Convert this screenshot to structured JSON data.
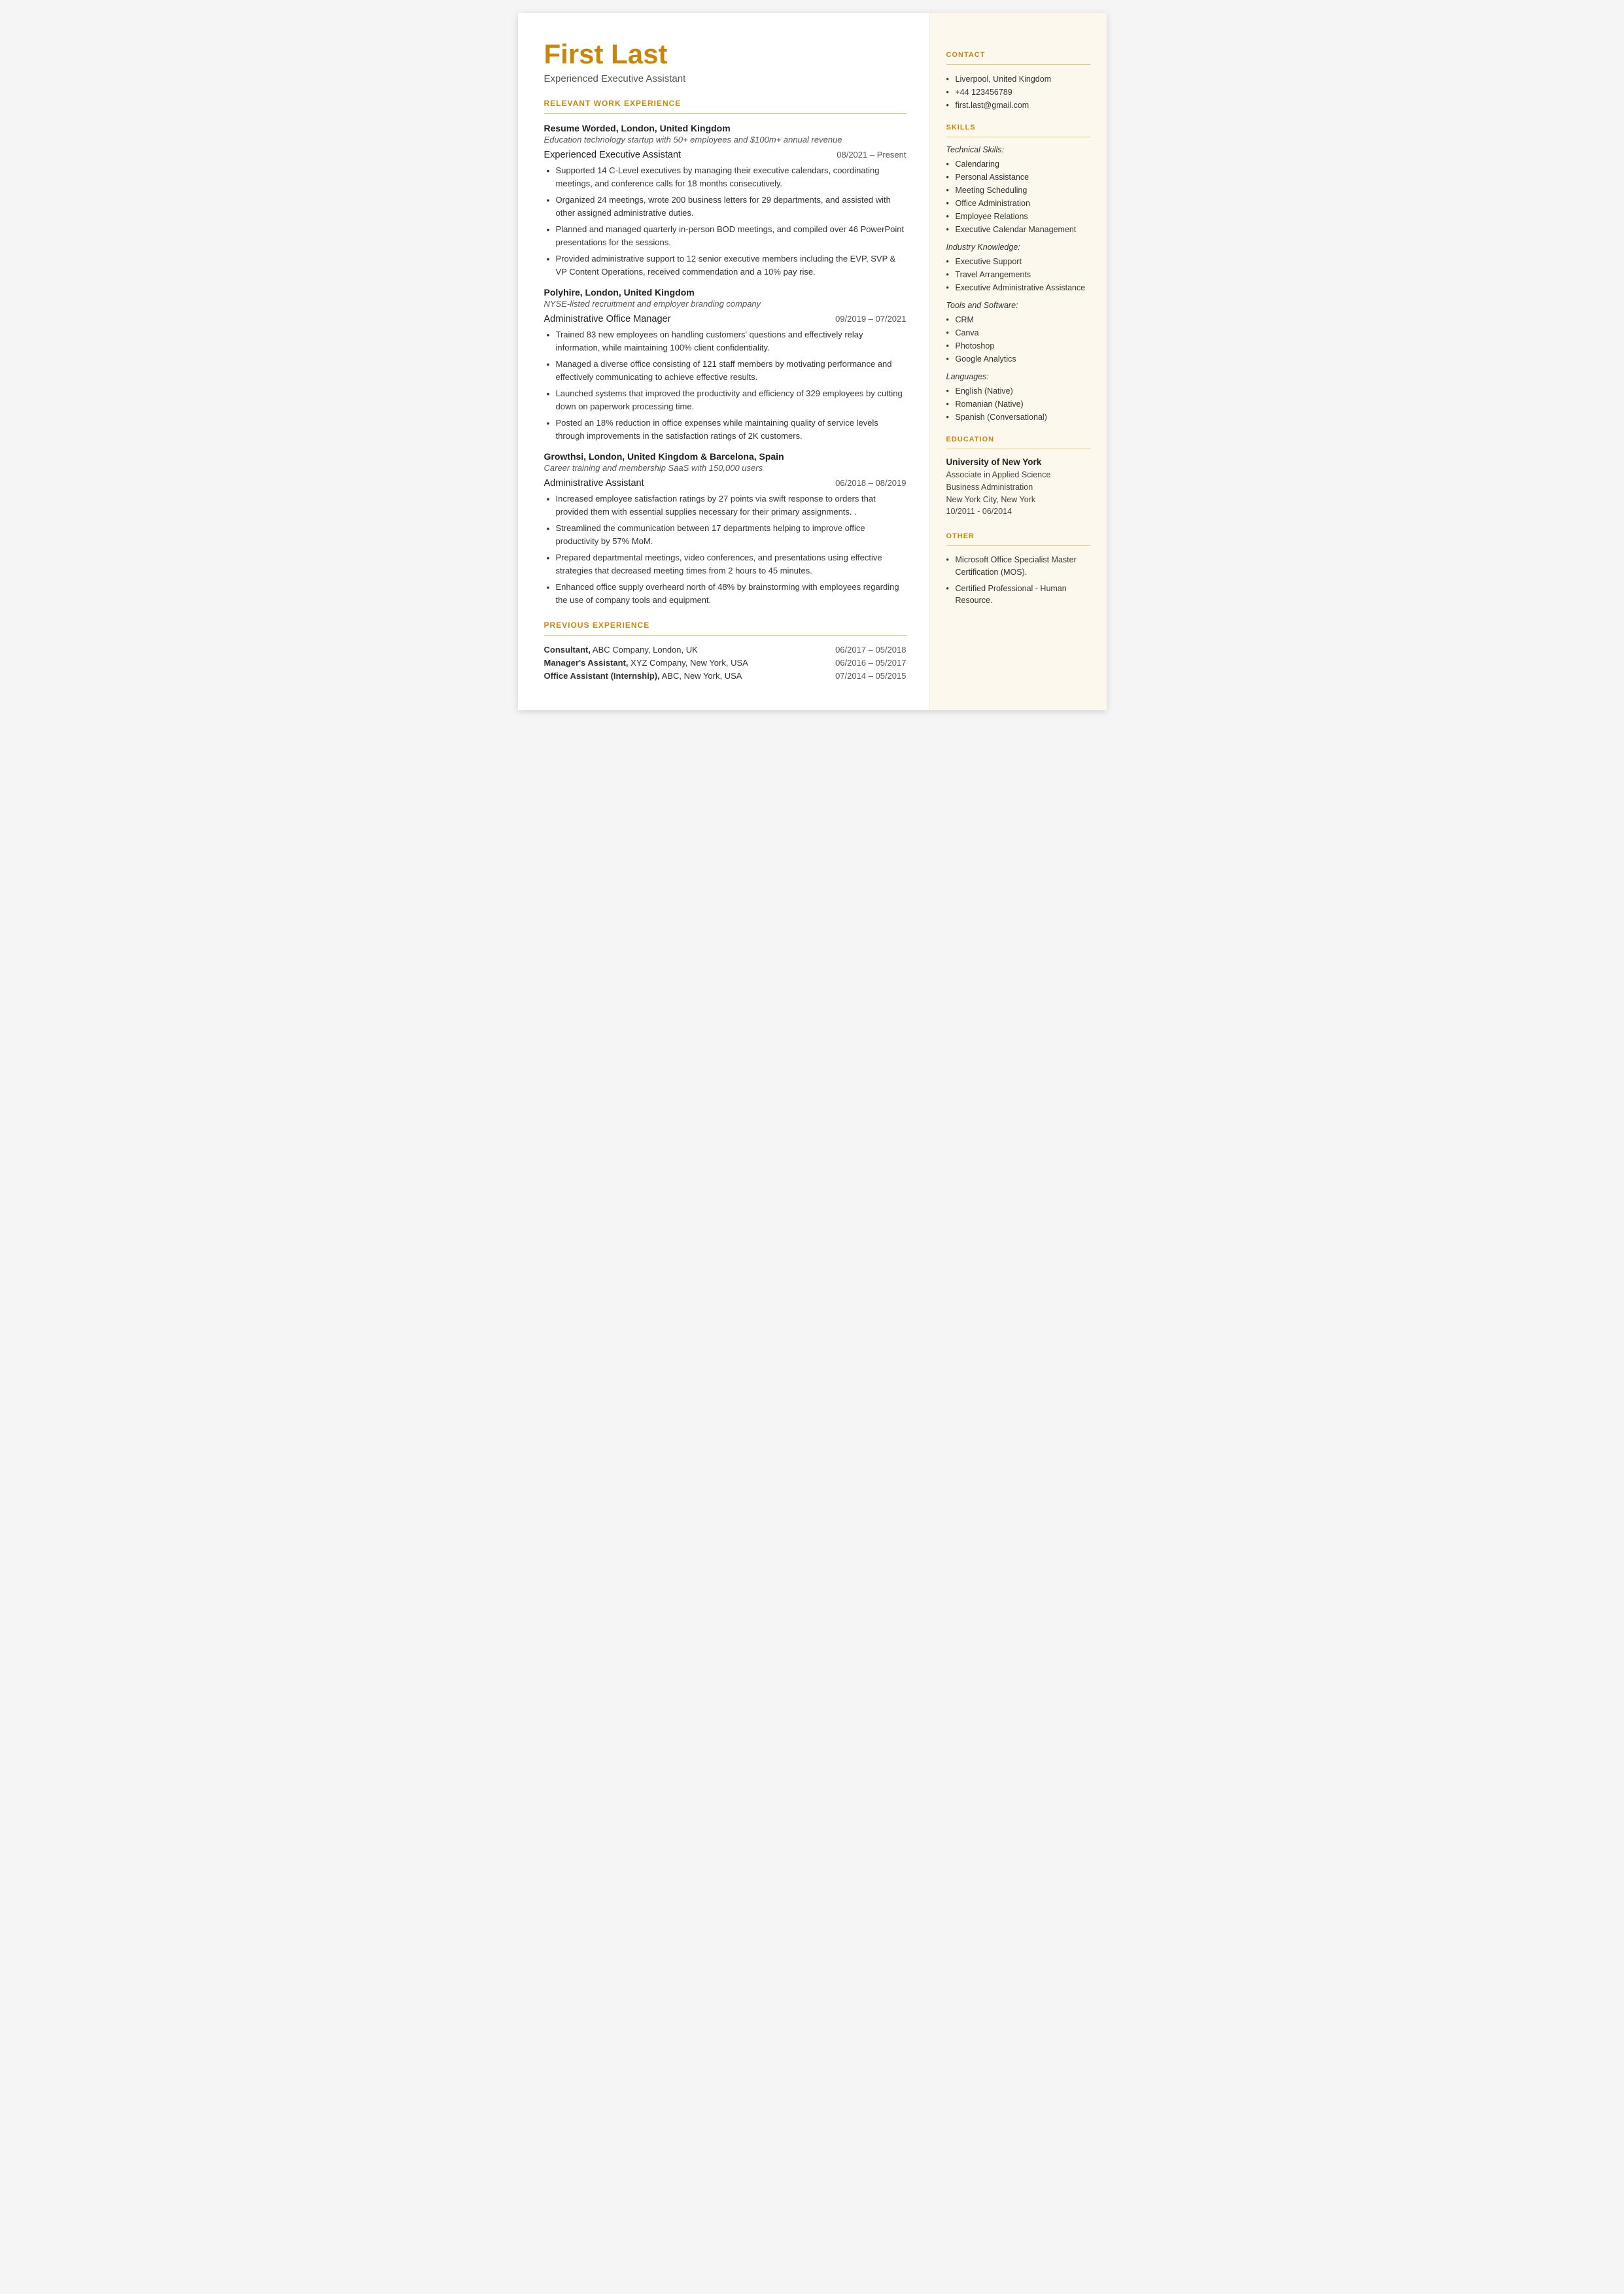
{
  "header": {
    "name": "First Last",
    "subtitle": "Experienced Executive Assistant"
  },
  "left": {
    "relevant_work_title": "RELEVANT WORK EXPERIENCE",
    "jobs": [
      {
        "company": "Resume Worded,",
        "company_rest": " London, United Kingdom",
        "italic": "Education technology startup with 50+ employees and $100m+ annual revenue",
        "role": "Experienced Executive Assistant",
        "dates": "08/2021 – Present",
        "bullets": [
          "Supported 14 C-Level executives by managing their executive calendars, coordinating meetings, and conference calls for 18 months consecutively.",
          "Organized 24 meetings, wrote 200 business letters for 29 departments, and assisted with other assigned administrative duties.",
          "Planned and managed quarterly in-person BOD meetings, and  compiled over 46 PowerPoint presentations for the sessions.",
          "Provided administrative support to 12 senior executive members including the EVP, SVP & VP Content Operations, received commendation and a 10% pay rise."
        ]
      },
      {
        "company": "Polyhire,",
        "company_rest": " London, United Kingdom",
        "italic": "NYSE-listed recruitment and employer branding company",
        "role": "Administrative Office Manager",
        "dates": "09/2019 – 07/2021",
        "bullets": [
          "Trained 83 new employees on handling customers' questions and effectively relay information, while maintaining 100% client confidentiality.",
          "Managed a diverse office consisting of 121 staff members by motivating performance and effectively communicating to achieve effective results.",
          "Launched systems that improved the productivity and efficiency  of 329 employees by cutting down on paperwork processing time.",
          "Posted an 18% reduction in office expenses while maintaining quality of service levels through improvements in the satisfaction ratings of 2K customers."
        ]
      },
      {
        "company": "Growthsi,",
        "company_rest": " London, United Kingdom & Barcelona, Spain",
        "italic": "Career training and membership SaaS with 150,000 users",
        "role": "Administrative Assistant",
        "dates": "06/2018 – 08/2019",
        "bullets": [
          "Increased employee satisfaction ratings by 27 points via swift response to orders that provided them with essential supplies necessary for their primary assignments. .",
          "Streamlined the communication between 17 departments helping to improve office productivity by 57% MoM.",
          "Prepared departmental meetings, video conferences, and presentations using effective strategies that decreased meeting times from 2 hours to 45 minutes.",
          "Enhanced office supply overheard north of 48% by brainstorming with employees regarding the use of company tools and equipment."
        ]
      }
    ],
    "previous_exp_title": "PREVIOUS EXPERIENCE",
    "previous_jobs": [
      {
        "label": "Consultant,",
        "label_rest": " ABC Company, London, UK",
        "dates": "06/2017 – 05/2018"
      },
      {
        "label": "Manager's Assistant,",
        "label_rest": " XYZ Company, New York, USA",
        "dates": "06/2016 – 05/2017"
      },
      {
        "label": "Office Assistant (Internship),",
        "label_rest": " ABC, New York, USA",
        "dates": "07/2014 – 05/2015"
      }
    ]
  },
  "right": {
    "contact_title": "CONTACT",
    "contact_items": [
      "Liverpool, United Kingdom",
      "+44 123456789",
      "first.last@gmail.com"
    ],
    "skills_title": "SKILLS",
    "skills_groups": [
      {
        "category": "Technical Skills:",
        "items": [
          "Calendaring",
          "Personal Assistance",
          "Meeting Scheduling",
          "Office Administration",
          "Employee Relations",
          "Executive Calendar Management"
        ]
      },
      {
        "category": "Industry Knowledge:",
        "items": [
          "Executive Support",
          "Travel Arrangements",
          "Executive Administrative Assistance"
        ]
      },
      {
        "category": "Tools and Software:",
        "items": [
          "CRM",
          "Canva",
          "Photoshop",
          "Google Analytics"
        ]
      },
      {
        "category": "Languages:",
        "items": [
          "English (Native)",
          "Romanian (Native)",
          "Spanish (Conversational)"
        ]
      }
    ],
    "education_title": "EDUCATION",
    "education": [
      {
        "institution": "University of New York",
        "degree": "Associate in Applied Science",
        "field": "Business Administration",
        "location": "New York City, New York",
        "dates": "10/2011 - 06/2014"
      }
    ],
    "other_title": "OTHER",
    "other_items": [
      "Microsoft Office Specialist Master Certification (MOS).",
      "Certified Professional - Human Resource."
    ]
  }
}
